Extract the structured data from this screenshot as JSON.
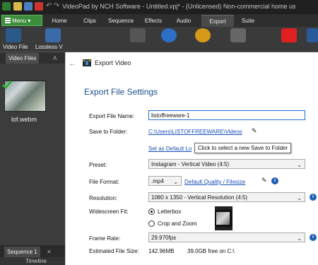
{
  "titlebar": {
    "title": "VideoPad by NCH Software - Untitled.vpj* - (Unlicensed) Non-commercial home us"
  },
  "tabbar": {
    "menu_label": "Menu",
    "tabs": [
      "Home",
      "Clips",
      "Sequence",
      "Effects",
      "Audio",
      "Export",
      "Suite"
    ],
    "active_tab": "Export"
  },
  "ribbon": {
    "buttons": [
      "Video File",
      "Lossless V"
    ]
  },
  "left_panel": {
    "tab_label": "Video Files",
    "tab_more": "A",
    "clip_name": "lof.webm",
    "sequence_tab": "Sequence 1",
    "sequence_close": "✕",
    "timeline_label": "Timeline"
  },
  "dialog": {
    "header_title": "Export Video",
    "section_title": "Export File Settings",
    "export_file_name_label": "Export File Name:",
    "export_file_name_value": "listoffreeware-1",
    "save_to_folder_label": "Save to Folder:",
    "save_to_folder_path": "C:\\Users\\LISTOFFREEWARE\\Videos",
    "set_as_default_link": "Set as Default Lo",
    "tooltip": "Click to select a new Save to Folder",
    "preset_label": "Preset:",
    "preset_value": "Instagram - Vertical Video (4:5)",
    "file_format_label": "File Format:",
    "file_format_value": ".mp4",
    "quality_link": "Default Quality / Filesize",
    "resolution_label": "Resolution:",
    "resolution_value": "1080 x 1350 - Vertical Resolution (4:5)",
    "widescreen_label": "Widescreen Fit:",
    "widescreen_options": [
      "Letterbox",
      "Crop and Zoom"
    ],
    "widescreen_selected": "Letterbox",
    "frame_rate_label": "Frame Rate:",
    "frame_rate_value": "29.970fps",
    "estimated_size_label": "Estimated File Size:",
    "estimated_size_value": "142.96MB",
    "free_space_value": "39.0GB free on C:\\"
  },
  "colors": {
    "accent_green": "#3b8c3b",
    "link_blue": "#1a4fb8",
    "title_blue": "#1a4f8a",
    "info_blue": "#1e5fb4"
  }
}
